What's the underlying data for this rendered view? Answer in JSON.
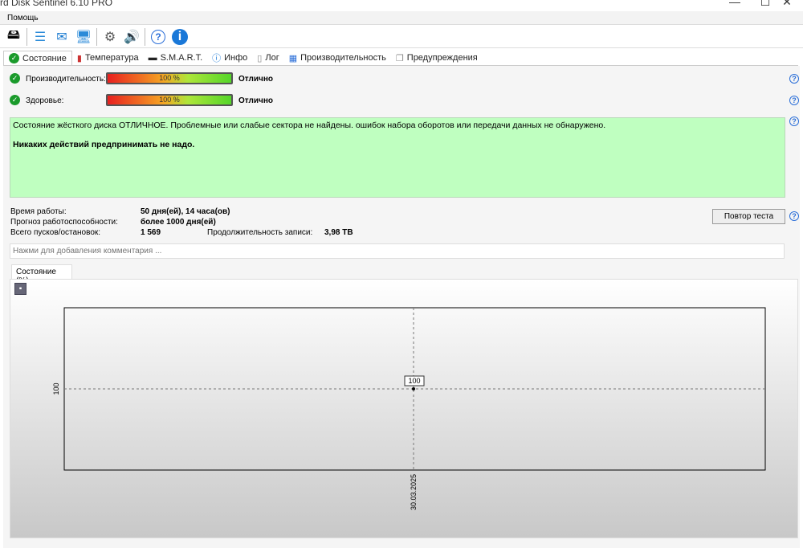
{
  "window": {
    "title": "rd Disk Sentinel 6.10 PRO"
  },
  "menu": {
    "items": [
      "Помощь"
    ]
  },
  "tabs": [
    {
      "label": "Состояние"
    },
    {
      "label": "Температура"
    },
    {
      "label": "S.M.A.R.T."
    },
    {
      "label": "Инфо"
    },
    {
      "label": "Лог"
    },
    {
      "label": "Производительность"
    },
    {
      "label": "Предупреждения"
    }
  ],
  "status": {
    "performance": {
      "label": "Производительность:",
      "percent": 100,
      "bar_text": "100 %",
      "rating": "Отлично"
    },
    "health": {
      "label": "Здоровье:",
      "percent": 100,
      "bar_text": "100 %",
      "rating": "Отлично"
    }
  },
  "message": {
    "line1": "Состояние жёсткого диска ОТЛИЧНОЕ. Проблемные или слабые сектора не найдены. ошибок набора оборотов или передачи данных не обнаружено.",
    "line2": "Никаких действий предпринимать не надо."
  },
  "info": {
    "uptime_label": "Время работы:",
    "uptime": "50 дня(ей), 14 часа(ов)",
    "forecast_label": "Прогноз работоспособности:",
    "forecast": "более 1000 дня(ей)",
    "starts_label": "Всего пусков/остановок:",
    "starts": "1 569",
    "write_label": "Продолжительность записи:",
    "write": "3,98 TB"
  },
  "retest_label": "Повтор теста",
  "comment_placeholder": "Нажми для добавления комментария ...",
  "chart_tab": "Состояние (%)",
  "chart_data": {
    "type": "line",
    "x": [
      "30.03.2025"
    ],
    "series": [
      {
        "name": "Состояние (%)",
        "values": [
          100
        ]
      }
    ],
    "ytick": "100",
    "xtick": "30.03.2025",
    "point_label": "100"
  }
}
